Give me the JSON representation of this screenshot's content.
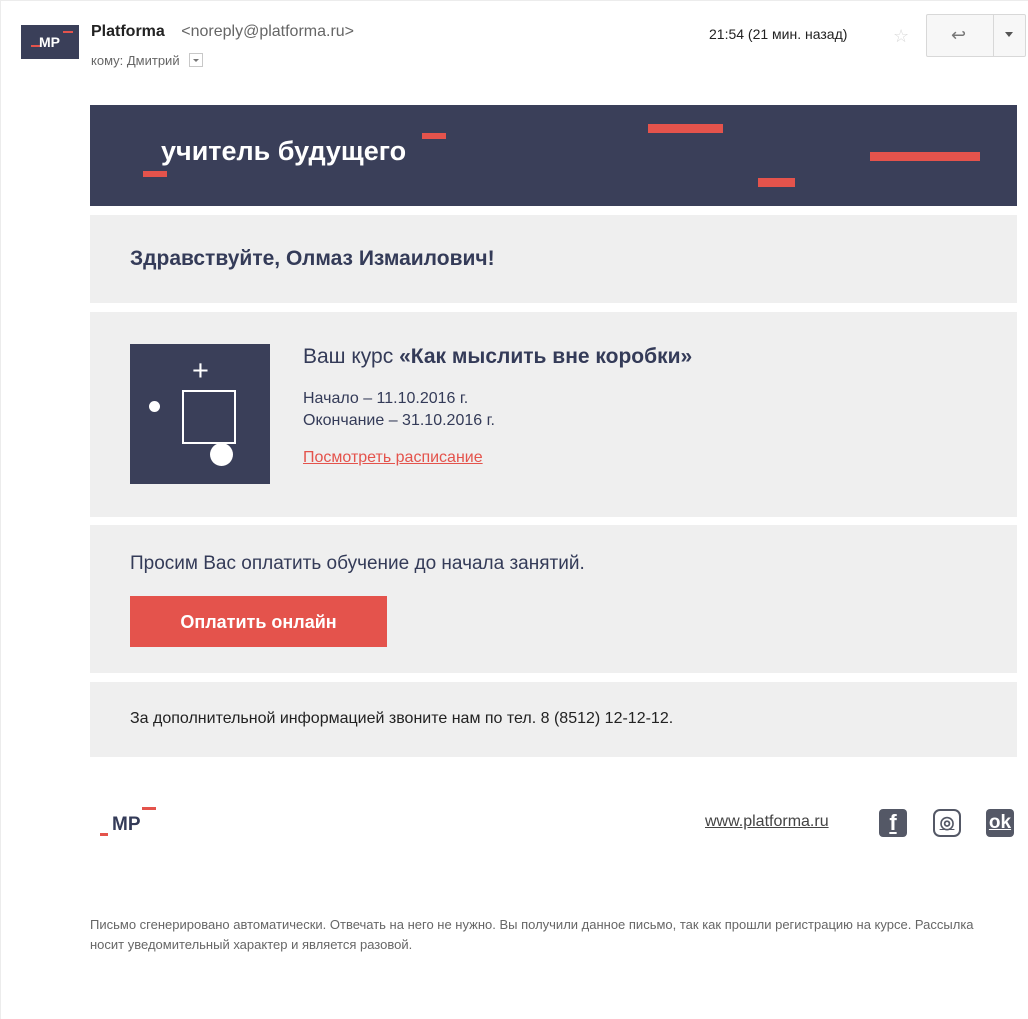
{
  "header": {
    "avatar_text": "MP",
    "sender_name": "Platforma",
    "sender_email": "<noreply@platforma.ru>",
    "recipient": "кому: Дмитрий",
    "time": "21:54 (21 мин. назад)"
  },
  "email": {
    "hero_title": "учитель будущего",
    "greeting": "Здравствуйте, Олмаз Измаилович!",
    "course_prefix": "Ваш курс",
    "course_name": "«Как мыслить вне коробки»",
    "start_date": "Начало – 11.10.2016 г.",
    "end_date": "Окончание – 31.10.2016 г.",
    "schedule_link": "Посмотреть расписание",
    "payment_text": "Просим Вас  оплатить обучение до начала занятий.",
    "payment_button": "Оплатить онлайн",
    "contact_text": "За дополнительной информацией звоните нам по тел. 8 (8512) 12-12-12."
  },
  "footer": {
    "logo_text": "MP",
    "website": "www.platforma.ru",
    "facebook": "f",
    "instagram": "◎",
    "odnoklassniki": "ok",
    "note": "Письмо сгенерировано автоматически. Отвечать на него не нужно. Вы получили данное письмо, так как прошли регистрацию на курсе. Рассылка носит уведомительный характер и является разовой."
  },
  "colors": {
    "brand_dark": "#3a3f59",
    "accent": "#e4534c",
    "panel": "#efefef"
  },
  "icons": [
    "star-icon",
    "reply-icon",
    "dropdown-caret-icon",
    "facebook-icon",
    "instagram-icon",
    "odnoklassniki-icon"
  ]
}
